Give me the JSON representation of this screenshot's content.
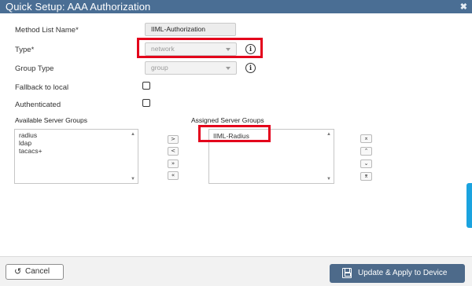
{
  "window": {
    "title": "Quick Setup: AAA Authorization",
    "close_glyph": "✖"
  },
  "form": {
    "method_list_name": {
      "label": "Method List Name*",
      "value": "IIML-Authorization"
    },
    "type": {
      "label": "Type*",
      "value": "network"
    },
    "group_type": {
      "label": "Group Type",
      "value": "group"
    },
    "fallback": {
      "label": "Fallback to local",
      "checked": false
    },
    "authenticated": {
      "label": "Authenticated",
      "checked": false
    },
    "info_glyph": "i"
  },
  "available_groups": {
    "label": "Available Server Groups",
    "items": [
      "radius",
      "ldap",
      "tacacs+"
    ]
  },
  "assigned_groups": {
    "label": "Assigned Server Groups",
    "items": [
      "IIML-Radius"
    ]
  },
  "move_buttons": [
    ">",
    "<",
    "»",
    "«"
  ],
  "order_buttons": [
    "⌅",
    "⌃",
    "⌄",
    "⌆"
  ],
  "scroll_arrows": {
    "up": "▲",
    "down": "▼"
  },
  "footer": {
    "cancel_label": "Cancel",
    "cancel_icon": "↺",
    "apply_label": "Update & Apply to Device"
  },
  "colors": {
    "titlebar": "#4a6e94",
    "highlight": "#e3001b",
    "apply_button": "#4d6a8a",
    "side_tab": "#1aa3df"
  }
}
